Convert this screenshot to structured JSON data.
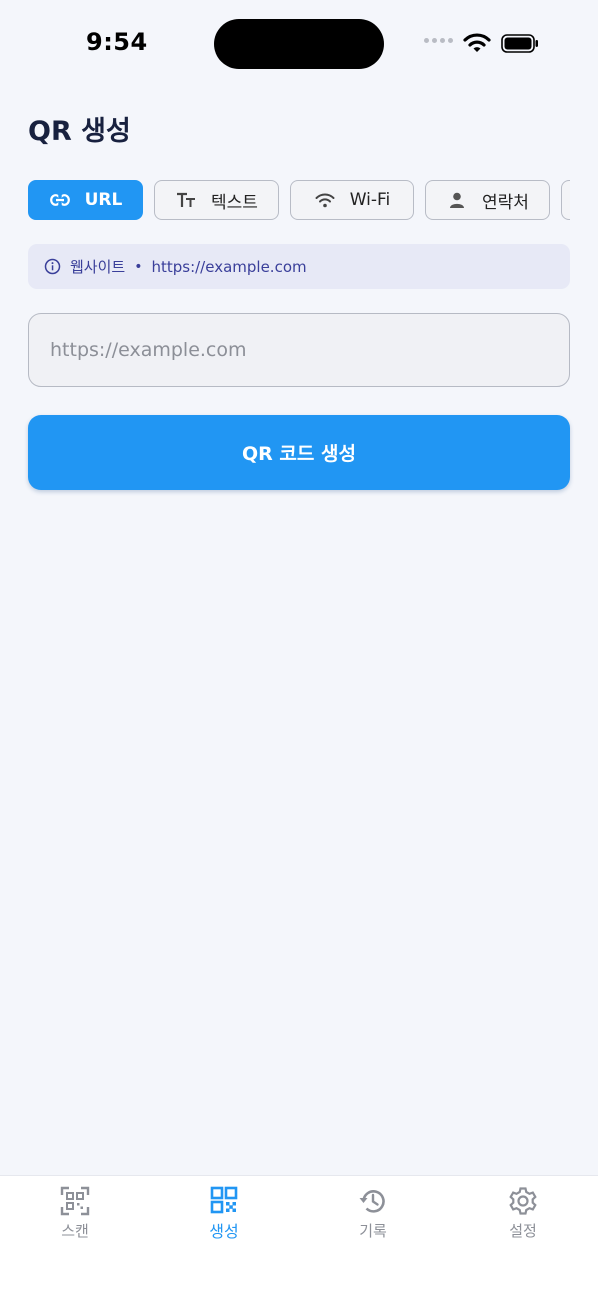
{
  "status": {
    "time": "9:54"
  },
  "page": {
    "title": "QR 생성"
  },
  "types": [
    {
      "label": "URL",
      "icon": "link-icon",
      "active": true
    },
    {
      "label": "텍스트",
      "icon": "text-icon",
      "active": false
    },
    {
      "label": "Wi-Fi",
      "icon": "wifi-icon",
      "active": false
    },
    {
      "label": "연락처",
      "icon": "person-icon",
      "active": false
    }
  ],
  "hint": {
    "category": "웹사이트",
    "separator": "•",
    "example": "https://example.com"
  },
  "input": {
    "value": "",
    "placeholder": "https://example.com"
  },
  "generate_button": {
    "label": "QR 코드 생성"
  },
  "nav": {
    "scan": "스캔",
    "create": "생성",
    "history": "기록",
    "settings": "설정",
    "active": "create"
  },
  "colors": {
    "accent": "#2196f3",
    "background": "#f4f6fb",
    "hint_bg": "#e7e9f6",
    "hint_text": "#3a3f9a"
  }
}
